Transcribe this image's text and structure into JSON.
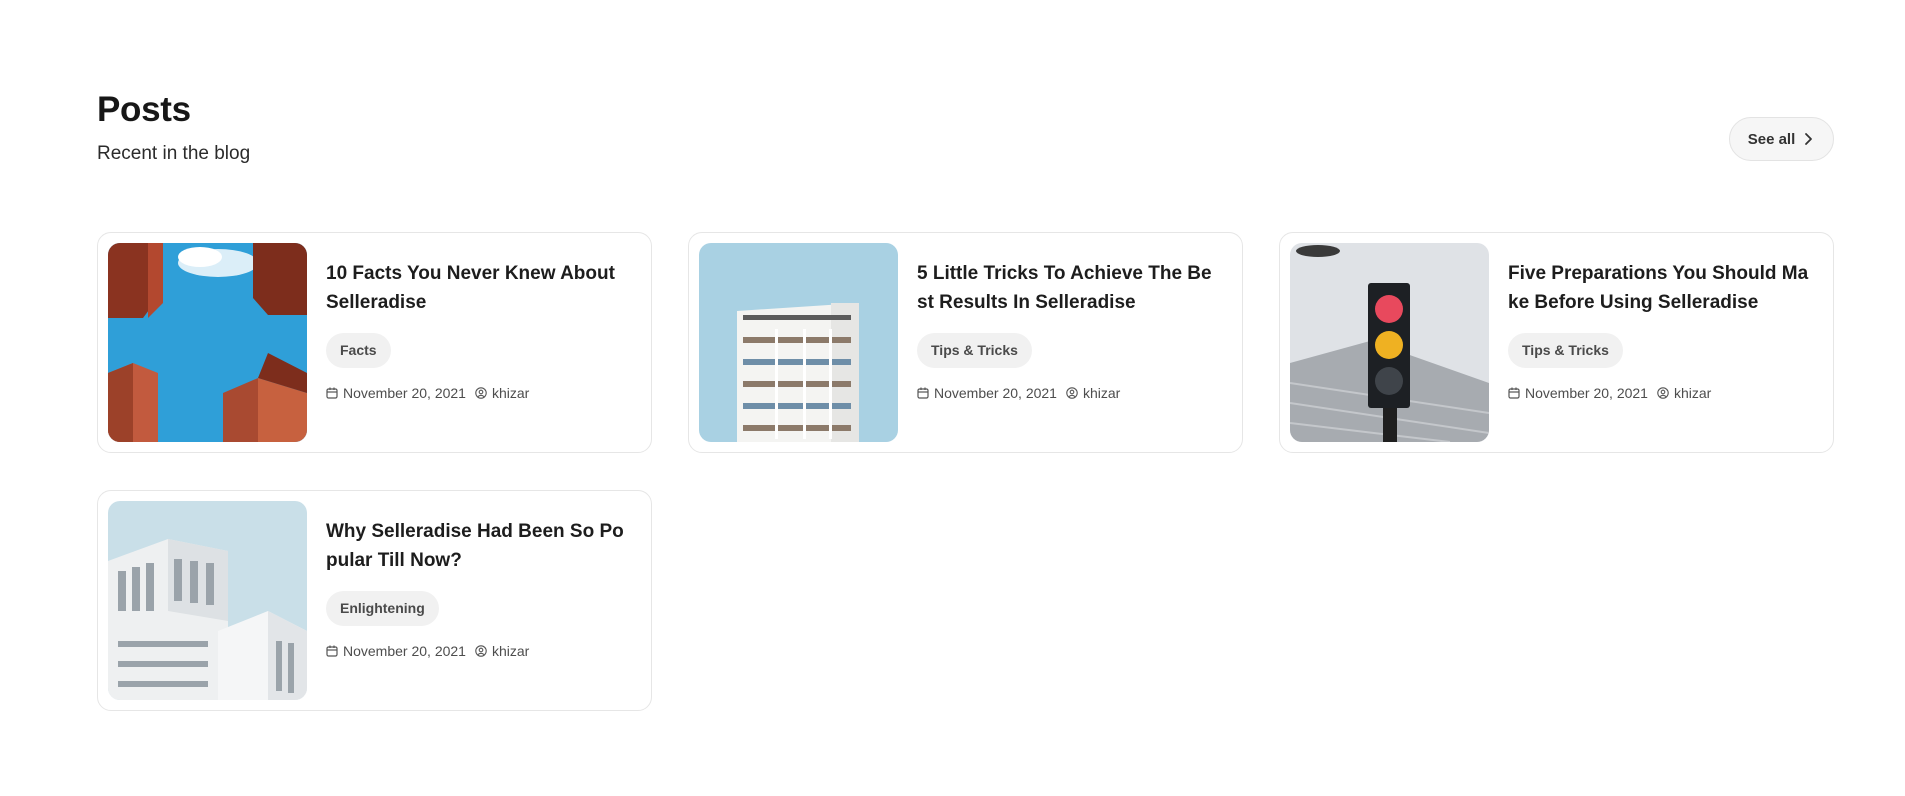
{
  "header": {
    "title": "Posts",
    "subtitle": "Recent in the blog",
    "see_all_label": "See all"
  },
  "posts": [
    {
      "title": "10 Facts You Never Knew About Selleradise",
      "tag": "Facts",
      "date": "November 20, 2021",
      "author": "khizar",
      "image": "red-walls-blue-sky"
    },
    {
      "title": "5 Little Tricks To Achieve The Best Results In Selleradise",
      "tag": "Tips & Tricks",
      "date": "November 20, 2021",
      "author": "khizar",
      "image": "white-tower-blue-sky"
    },
    {
      "title": "Five Preparations You Should Make Before Using Selleradise",
      "tag": "Tips & Tricks",
      "date": "November 20, 2021",
      "author": "khizar",
      "image": "traffic-light"
    },
    {
      "title": "Why Selleradise Had Been So Popular Till Now?",
      "tag": "Enlightening",
      "date": "November 20, 2021",
      "author": "khizar",
      "image": "white-building"
    }
  ],
  "colors": {
    "text": "#1a1a1a",
    "border": "#e6e6e6",
    "tag_bg": "#f1f1f1",
    "accent_sky": "#2d9bd6"
  },
  "icons": {
    "date": "calendar-icon",
    "author": "user-icon",
    "see_all": "chevron-right-icon"
  }
}
